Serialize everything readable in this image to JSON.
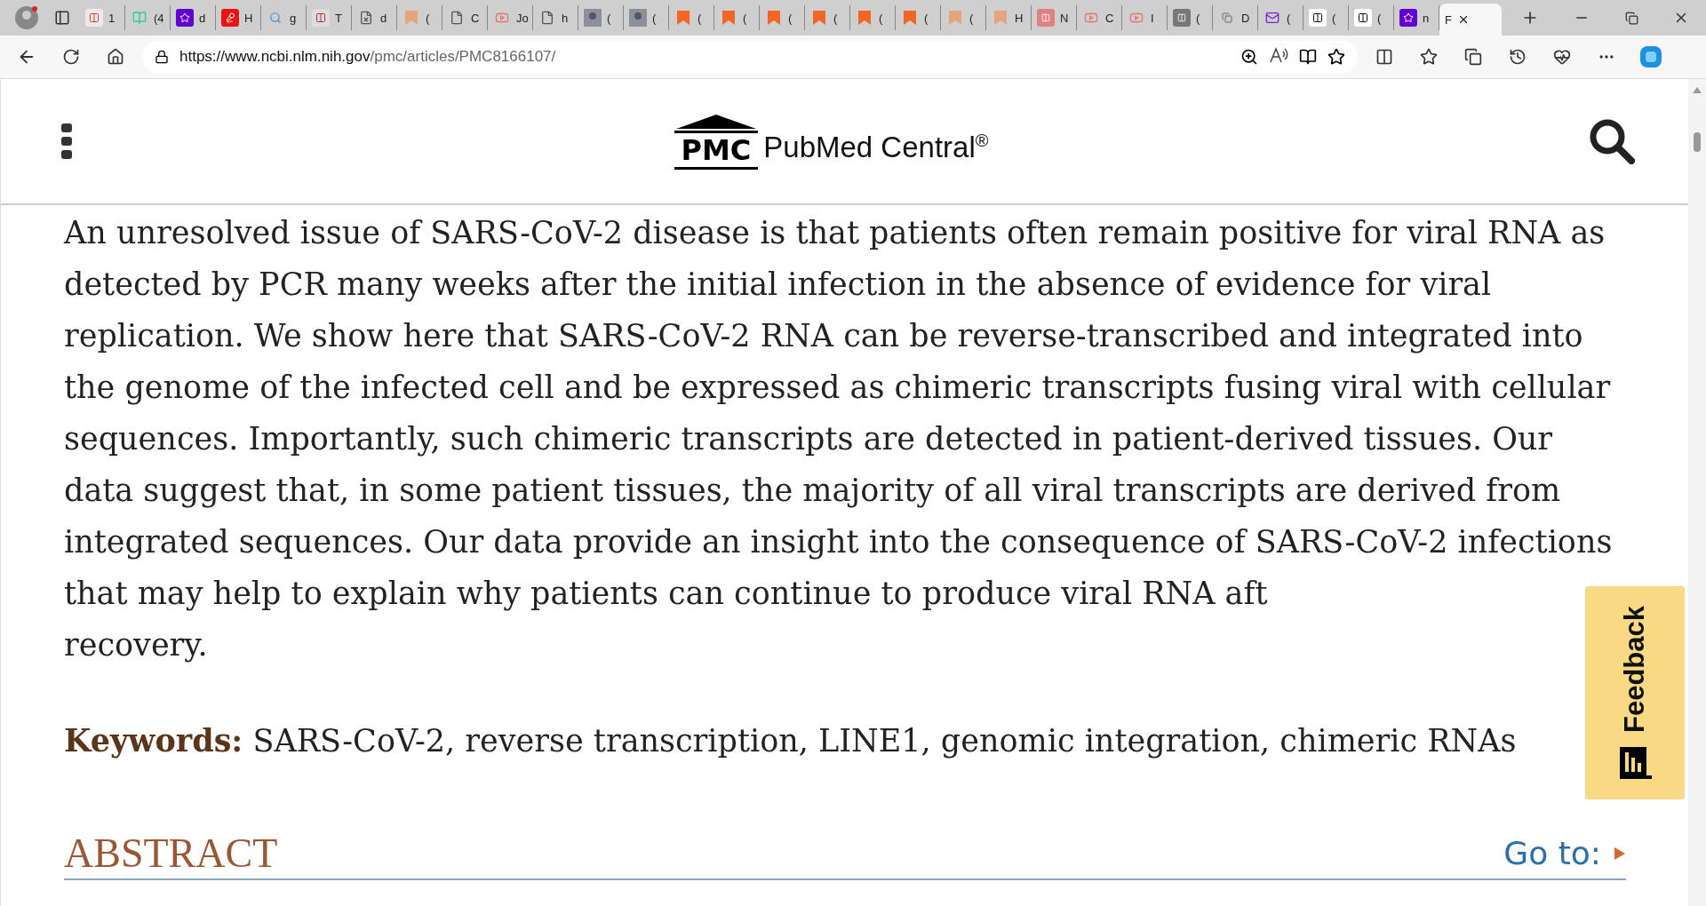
{
  "browser": {
    "tabs": [
      {
        "kind": "bi",
        "title": "1",
        "selected": false
      },
      {
        "kind": "g",
        "title": "(4",
        "selected": false
      },
      {
        "kind": "yahoo",
        "title": "d",
        "selected": false
      },
      {
        "kind": "red",
        "title": "H",
        "selected": false
      },
      {
        "kind": "search",
        "title": "g",
        "selected": false
      },
      {
        "kind": "ds",
        "title": "T",
        "selected": false
      },
      {
        "kind": "filex",
        "title": "d",
        "selected": false
      },
      {
        "kind": "faded",
        "title": "(",
        "selected": false
      },
      {
        "kind": "file",
        "title": "C",
        "selected": false
      },
      {
        "kind": "youtube",
        "title": "Jo",
        "selected": false
      },
      {
        "kind": "file",
        "title": "h",
        "selected": false
      },
      {
        "kind": "photo",
        "title": "(",
        "selected": false
      },
      {
        "kind": "photo",
        "title": "(",
        "selected": false
      },
      {
        "kind": "bookmark",
        "title": "(",
        "selected": false
      },
      {
        "kind": "bookmark",
        "title": "(",
        "selected": false
      },
      {
        "kind": "bookmark",
        "title": "(",
        "selected": false
      },
      {
        "kind": "bookmark",
        "title": "(",
        "selected": false
      },
      {
        "kind": "bookmark",
        "title": "(",
        "selected": false
      },
      {
        "kind": "bookmark",
        "title": "(",
        "selected": false
      },
      {
        "kind": "faded",
        "title": "(",
        "selected": false
      },
      {
        "kind": "faded",
        "title": "H",
        "selected": false
      },
      {
        "kind": "r",
        "title": "N",
        "selected": false
      },
      {
        "kind": "youtube",
        "title": "C",
        "selected": false
      },
      {
        "kind": "youtube",
        "title": "I",
        "selected": false
      },
      {
        "kind": "bird",
        "title": "(",
        "selected": false
      },
      {
        "kind": "dr",
        "title": "D",
        "selected": false
      },
      {
        "kind": "mail",
        "title": "(",
        "selected": false
      },
      {
        "kind": "od",
        "title": "(",
        "selected": false
      },
      {
        "kind": "od",
        "title": "(",
        "selected": false
      },
      {
        "kind": "yahoo",
        "title": "n",
        "selected": false
      },
      {
        "kind": "page",
        "title": "F",
        "selected": true
      }
    ],
    "url_host": "https://www.ncbi.nlm.nih.gov",
    "url_path": "/pmc/articles/PMC8166107/"
  },
  "header": {
    "logo_mark": "PMC",
    "logo_text": "PubMed Central",
    "logo_sup": "®"
  },
  "article": {
    "paragraph": "An unresolved issue of SARS-CoV-2 disease is that patients often remain positive for viral RNA as detected by PCR many weeks after the initial infection in the absence of evidence for viral replication. We show here that SARS-CoV-2 RNA can be reverse-transcribed and integrated into the genome of the infected cell and be expressed as chimeric transcripts fusing viral with cellular sequences. Importantly, such chimeric transcripts are detected in patient-derived tissues. Our data suggest that, in some patient tissues, the majority of all viral transcripts are derived from integrated sequences. Our data provide an insight into the consequence of SARS-CoV-2 infections that may help to explain why patients can continue to produce viral RNA aft",
    "paragraph_end": "recovery.",
    "keywords_label": "Keywords:",
    "keywords": "SARS-CoV-2, reverse transcription, LINE1, genomic integration, chimeric RNAs",
    "section_title": "ABSTRACT",
    "goto": "Go to:"
  },
  "feedback": {
    "label": "Feedback"
  }
}
